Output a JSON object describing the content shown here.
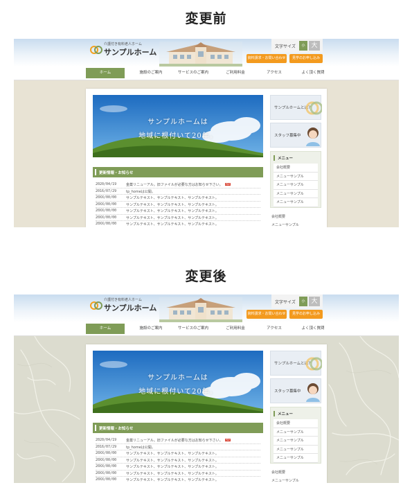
{
  "titles": {
    "before": "変更前",
    "after": "変更後"
  },
  "site": {
    "logo_sub": "介護付き有料老人ホーム",
    "logo_name": "サンプルホーム",
    "font_size_label": "文字サイズ",
    "font_small": "小",
    "font_large": "大",
    "btn_docs": "資料請求・お問い合わせ",
    "btn_tour": "見学のお申し込み",
    "nav": [
      "ホーム",
      "施設のご案内",
      "サービスのご案内",
      "ご利用料金",
      "アクセス",
      "よく頂く質問"
    ],
    "hero_line1": "サンプルホームは",
    "hero_line2": "地域に根付いて20年。",
    "news_title": "更新情報・お知らせ",
    "news": [
      {
        "date": "2020/04/19",
        "text": "金薬リニューアル。旧ファイルが必要な方はお知らせ下さい。",
        "pdf": "PDF"
      },
      {
        "date": "2016/07/29",
        "text": "tp_homeは公開。",
        "pdf": ""
      },
      {
        "date": "20XX/00/00",
        "text": "サンプルテキスト、サンプルテキスト、サンプルテキスト。",
        "pdf": ""
      },
      {
        "date": "20XX/00/00",
        "text": "サンプルテキスト、サンプルテキスト、サンプルテキスト。",
        "pdf": ""
      },
      {
        "date": "20XX/00/00",
        "text": "サンプルテキスト、サンプルテキスト、サンプルテキスト。",
        "pdf": ""
      },
      {
        "date": "20XX/00/00",
        "text": "サンプルテキスト、サンプルテキスト、サンプルテキスト。",
        "pdf": ""
      },
      {
        "date": "20XX/00/00",
        "text": "サンプルテキスト、サンプルテキスト、サンプルテキスト。",
        "pdf": ""
      }
    ],
    "side_about": "サンプルホームとは？",
    "side_staff": "スタッフ募集中",
    "side_menu_title": "メニュー",
    "side_menu": [
      "会社概要",
      "メニューサンプル",
      "メニューサンプル",
      "メニューサンプル",
      "メニューサンプル"
    ],
    "side_extra": [
      "会社概要",
      "メニューサンプル"
    ]
  },
  "colors": {
    "accent": "#7f9c57",
    "orange": "#f39a1e",
    "bg_before": "#e8e3d4",
    "bg_after": "#dcdccf"
  }
}
